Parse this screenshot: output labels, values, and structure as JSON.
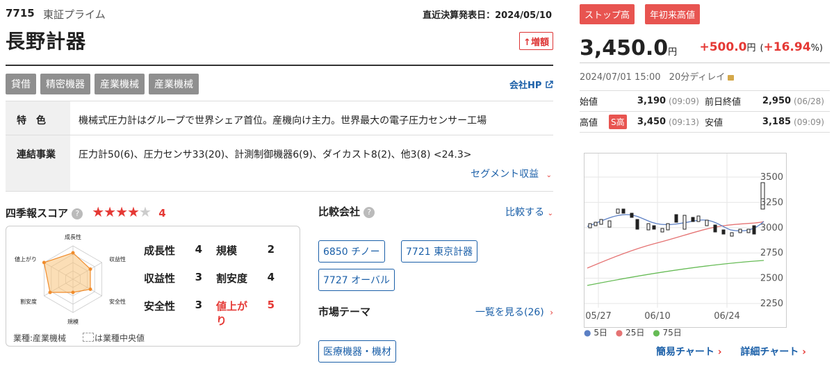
{
  "header": {
    "code": "7715",
    "market": "東証プライム",
    "kessan": "直近決算発表日：2024/05/10",
    "company_name": "長野計器",
    "badge_zougaku": "↑増額"
  },
  "tags": [
    "貸借",
    "精密機器",
    "産業機械",
    "産業機械"
  ],
  "company_hp": "会社HP",
  "info": {
    "tokushoku_label": "特　色",
    "tokushoku": "機械式圧力計はグループで世界シェア首位。産機向け主力。世界最大の電子圧力センサー工場",
    "renketsu_label": "連結事業",
    "renketsu": "圧力計50(6)、圧力センサ33(20)、計測制御機器6(9)、ダイカスト8(2)、他3(8) <24.3>",
    "segment_link": "セグメント収益"
  },
  "score": {
    "title": "四季報スコア",
    "stars": 4,
    "stars_text": "4",
    "radar_labels": [
      "成長性",
      "収益性",
      "安全性",
      "規模",
      "割安度",
      "値上がり"
    ],
    "items": [
      {
        "name": "成長性",
        "value": "4"
      },
      {
        "name": "規模",
        "value": "2"
      },
      {
        "name": "収益性",
        "value": "3"
      },
      {
        "name": "割安度",
        "value": "4"
      },
      {
        "name": "安全性",
        "value": "3"
      },
      {
        "name": "値上がり",
        "value": "5"
      }
    ],
    "legend_industry": "業種:産業機械",
    "legend_median": "は業種中央値"
  },
  "compare": {
    "title": "比較会社",
    "link": "比較する",
    "companies": [
      "6850 チノー",
      "7721 東京計器",
      "7727 オーバル"
    ]
  },
  "theme": {
    "title": "市場テーマ",
    "link": "一覧を見る(26)",
    "items": [
      "医療機器・機材"
    ]
  },
  "quote": {
    "badges": [
      "ストップ高",
      "年初来高値"
    ],
    "price": "3,450.0",
    "price_unit": "円",
    "change": "+500.0",
    "change_unit": "円",
    "change_pct": "+16.94",
    "change_pct_unit": "%",
    "timestamp": "2024/07/01 15:00",
    "delay": "20分ディレイ",
    "open_label": "始値",
    "open": "3,190",
    "open_time": "(09:09)",
    "prev_label": "前日終値",
    "prev": "2,950",
    "prev_time": "(06/28)",
    "high_label": "高値",
    "high_badge": "S高",
    "high": "3,450",
    "high_time": "(09:13)",
    "low_label": "安値",
    "low": "3,185",
    "low_time": "(09:09)"
  },
  "chart_data": {
    "type": "line",
    "x_ticks": [
      "05/27",
      "06/10",
      "06/24"
    ],
    "y_ticks": [
      "3500",
      "3250",
      "3000",
      "2750",
      "2500",
      "2250"
    ],
    "ylim": [
      2250,
      3500
    ],
    "legend": [
      {
        "name": "5日",
        "color": "#5b7fc4"
      },
      {
        "name": "25日",
        "color": "#e57373"
      },
      {
        "name": "75日",
        "color": "#66bb55"
      }
    ]
  },
  "chart_links": {
    "simple": "簡易チャート",
    "detail": "詳細チャート"
  }
}
